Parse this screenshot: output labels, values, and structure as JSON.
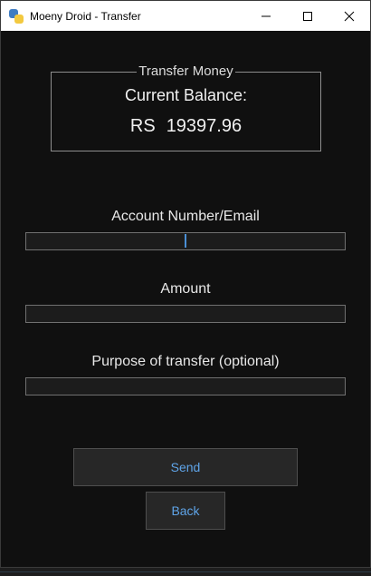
{
  "window": {
    "title": "Moeny Droid - Transfer"
  },
  "balance_box": {
    "legend": "Transfer Money",
    "label": "Current Balance:",
    "currency": "RS",
    "amount": "19397.96"
  },
  "form": {
    "account_label": "Account Number/Email",
    "account_value": "",
    "amount_label": "Amount",
    "amount_value": "",
    "purpose_label": "Purpose of transfer (optional)",
    "purpose_value": ""
  },
  "buttons": {
    "send": "Send",
    "back": "Back"
  },
  "colors": {
    "background": "#101010",
    "button_text": "#5fa4e8",
    "caret": "#4a8fd6"
  },
  "icons": [
    "python-app-icon",
    "minimize-icon",
    "maximize-icon",
    "close-icon"
  ]
}
